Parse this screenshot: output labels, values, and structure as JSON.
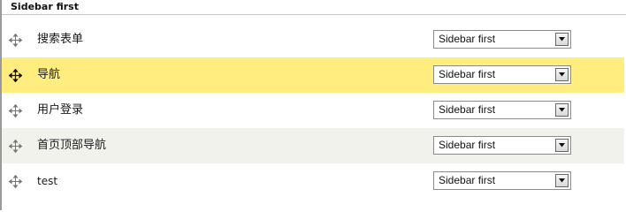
{
  "section": {
    "title": "Sidebar first"
  },
  "rows": [
    {
      "label": "搜索表单",
      "region": "Sidebar first",
      "highlighted": false
    },
    {
      "label": "导航",
      "region": "Sidebar first",
      "highlighted": true
    },
    {
      "label": "用户登录",
      "region": "Sidebar first",
      "highlighted": false
    },
    {
      "label": "首页顶部导航",
      "region": "Sidebar first",
      "highlighted": false
    },
    {
      "label": "test",
      "region": "Sidebar first",
      "highlighted": false
    }
  ],
  "colors": {
    "highlight": "#ffed80",
    "alt_row": "#f2f2ed"
  },
  "icons": {
    "drag": "move-arrows-icon",
    "dropdown": "triangle-down-icon"
  }
}
